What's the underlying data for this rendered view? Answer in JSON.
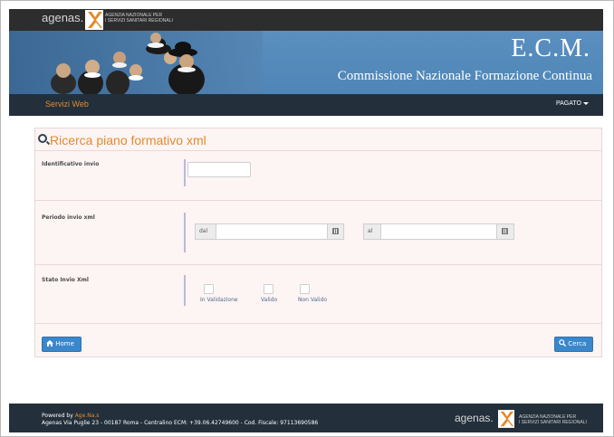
{
  "header": {
    "agenas_logo": "agenas.",
    "agenas_sub_line1": "AGENZIA NAZIONALE PER",
    "agenas_sub_line2": "I SERVIZI SANITARI REGIONALI",
    "banner_title": "E.C.M.",
    "banner_subtitle": "Commissione Nazionale Formazione Continua"
  },
  "navbar": {
    "brand": "Servizi Web",
    "user_menu": "PAGATO"
  },
  "panel": {
    "title": "Ricerca piano formativo xml",
    "fields": {
      "identificativo_label": "Identificativo invio",
      "identificativo_value": "",
      "periodo_label": "Periodo invio xml",
      "dal_addon": "dal",
      "dal_value": "",
      "al_addon": "al",
      "al_value": "",
      "stato_label": "Stato Invio Xml",
      "stato_options": [
        {
          "label": "In Validazione",
          "checked": false
        },
        {
          "label": "Valido",
          "checked": false
        },
        {
          "label": "Non Valido",
          "checked": false
        }
      ]
    },
    "buttons": {
      "home": "Home",
      "cerca": "Cerca"
    }
  },
  "footer": {
    "powered_by": "Powered by",
    "powered_link": "Age.Na.s",
    "address": "Agenas Via Puglie 23 - 00187 Roma - Centralino ECM: +39.06.42749600 - Cod. Fiscale: 97113690586",
    "logo": "agenas.",
    "sub_line1": "AGENZIA NAZIONALE PER",
    "sub_line2": "I SERVIZI SANITARI REGIONALI"
  },
  "colors": {
    "accent_orange": "#e38a2d",
    "nav_dark": "#23303b",
    "banner_blue": "#5a8fbf",
    "button_blue": "#3a87cc",
    "panel_bg": "#fdf4f4"
  }
}
